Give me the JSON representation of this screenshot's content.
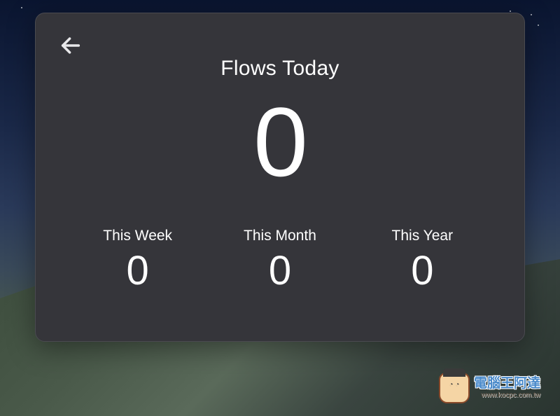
{
  "main": {
    "title": "Flows Today",
    "value": "0"
  },
  "stats": [
    {
      "label": "This Week",
      "value": "0"
    },
    {
      "label": "This Month",
      "value": "0"
    },
    {
      "label": "This Year",
      "value": "0"
    }
  ],
  "watermark": {
    "main": "電腦王阿達",
    "sub": "www.kocpc.com.tw"
  }
}
